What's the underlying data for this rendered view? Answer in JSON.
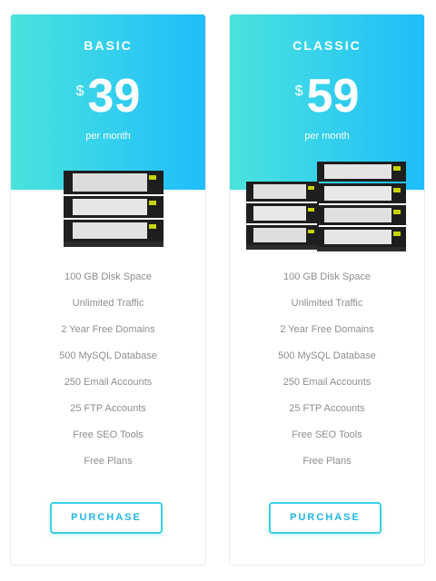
{
  "plans": [
    {
      "name": "BASIC",
      "currency": "$",
      "price": "39",
      "period": "per month",
      "features": [
        "100 GB Disk Space",
        "Unlimited Traffic",
        "2 Year Free Domains",
        "500 MySQL Database",
        "250 Email Accounts",
        "25 FTP Accounts",
        "Free SEO Tools",
        "Free Plans"
      ],
      "button_label": "PURCHASE",
      "server_icon": "server-rack-icon"
    },
    {
      "name": "CLASSIC",
      "currency": "$",
      "price": "59",
      "period": "per month",
      "features": [
        "100 GB Disk Space",
        "Unlimited Traffic",
        "2 Year Free Domains",
        "500 MySQL Database",
        "250 Email Accounts",
        "25 FTP Accounts",
        "Free SEO Tools",
        "Free Plans"
      ],
      "button_label": "PURCHASE",
      "server_icon": "server-racks-icon"
    }
  ],
  "colors": {
    "gradient_start": "#4ae3dd",
    "gradient_end": "#1fbdfb",
    "button_text": "#1fb6e6",
    "feature_text": "#8b8f93"
  }
}
